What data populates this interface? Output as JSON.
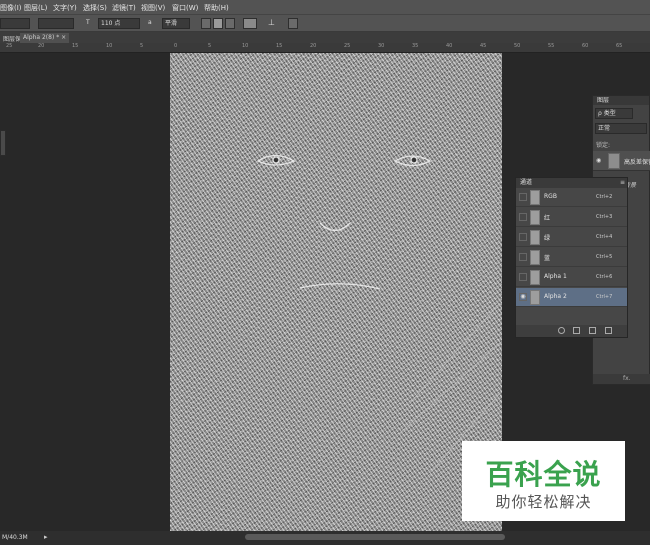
{
  "menu": [
    "图像(I)",
    "图层(L)",
    "文字(Y)",
    "选择(S)",
    "滤镜(T)",
    "视图(V)",
    "窗口(W)",
    "帮助(H)"
  ],
  "options": {
    "font_size": "110 点",
    "aa_mode": "平滑"
  },
  "tabs": [
    "图层保留",
    "Alpha 2(8) * ×"
  ],
  "ruler": [
    "25",
    "20",
    "15",
    "10",
    "5",
    "0",
    "5",
    "10",
    "15",
    "20",
    "25",
    "30",
    "35",
    "40",
    "45",
    "50",
    "55",
    "60",
    "65"
  ],
  "status": {
    "doc_size": "M/40.3M"
  },
  "layers_panel": {
    "title": "图层",
    "filter_kind": "ρ 类型",
    "blend_mode": "正常",
    "lock_label": "锁定:",
    "layer_name": "高反差保留",
    "bg_label": "背景"
  },
  "channels_panel": {
    "title": "通道",
    "rows": [
      {
        "name": "RGB",
        "shortcut": "Ctrl+2",
        "selected": false
      },
      {
        "name": "红",
        "shortcut": "Ctrl+3",
        "selected": false
      },
      {
        "name": "绿",
        "shortcut": "Ctrl+4",
        "selected": false
      },
      {
        "name": "蓝",
        "shortcut": "Ctrl+5",
        "selected": false
      },
      {
        "name": "Alpha 1",
        "shortcut": "Ctrl+6",
        "selected": false
      },
      {
        "name": "Alpha 2",
        "shortcut": "Ctrl+7",
        "selected": true
      }
    ]
  },
  "watermark": {
    "title": "百科全说",
    "subtitle": "助你轻松解决"
  }
}
